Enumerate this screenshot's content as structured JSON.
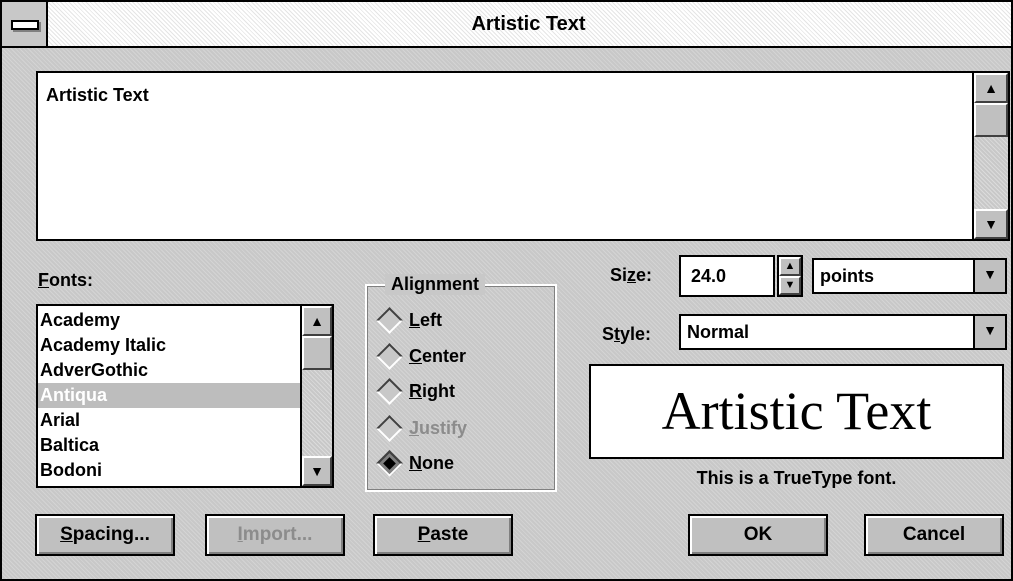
{
  "window": {
    "title": "Artistic Text"
  },
  "text_editor": {
    "value": "Artistic Text"
  },
  "fonts": {
    "label_accel": "F",
    "label_rest": "onts:",
    "items": [
      "Academy",
      "Academy Italic",
      "AdverGothic",
      "Antiqua",
      "Arial",
      "Baltica",
      "Bodoni"
    ],
    "selected": "Antiqua"
  },
  "alignment": {
    "title": "Alignment",
    "options": [
      {
        "accel": "L",
        "rest": "eft",
        "selected": false,
        "enabled": true
      },
      {
        "accel": "C",
        "rest": "enter",
        "selected": false,
        "enabled": true
      },
      {
        "accel": "R",
        "rest": "ight",
        "selected": false,
        "enabled": true
      },
      {
        "accel": "J",
        "rest": "ustify",
        "selected": false,
        "enabled": false
      },
      {
        "accel": "N",
        "rest": "one",
        "selected": true,
        "enabled": true
      }
    ]
  },
  "size": {
    "label_pre": "Si",
    "label_accel": "z",
    "label_post": "e:",
    "value": "24.0",
    "unit": "points"
  },
  "style": {
    "label_pre": "S",
    "label_accel": "t",
    "label_post": "yle:",
    "value": "Normal"
  },
  "preview": {
    "sample_text": "Artistic Text",
    "note": "This is a TrueType font."
  },
  "buttons": {
    "spacing_accel": "S",
    "spacing_rest": "pacing...",
    "import_accel": "I",
    "import_rest": "mport...",
    "paste_accel": "P",
    "paste_rest": "aste",
    "ok": "OK",
    "cancel": "Cancel"
  },
  "icons": {
    "scroll_up": "▲",
    "scroll_down": "▼",
    "dropdown": "▼"
  }
}
